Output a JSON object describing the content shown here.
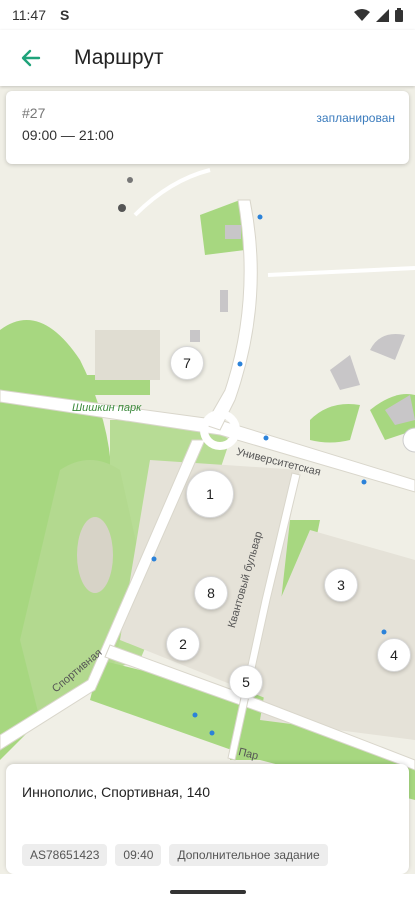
{
  "status_bar": {
    "time": "11:47",
    "sync_icon": "S"
  },
  "app_bar": {
    "title": "Маршрут"
  },
  "route_card": {
    "number": "#27",
    "time_range": "09:00 — 21:00",
    "status": "запланирован"
  },
  "map": {
    "street_labels": [
      "Университетская",
      "Квантовый бульвар",
      "Спортивная",
      "Пар"
    ],
    "park_label": "Шишкин парк",
    "markers": [
      "1",
      "2",
      "3",
      "4",
      "5",
      "7",
      "8"
    ]
  },
  "address_card": {
    "address": "Иннополис, Спортивная, 140",
    "chips": [
      "AS78651423",
      "09:40",
      "Дополнительное задание"
    ]
  },
  "colors": {
    "accent": "#1fa37a",
    "status_link": "#3a7bbd",
    "park": "#a7d780",
    "land": "#f0efe6"
  }
}
